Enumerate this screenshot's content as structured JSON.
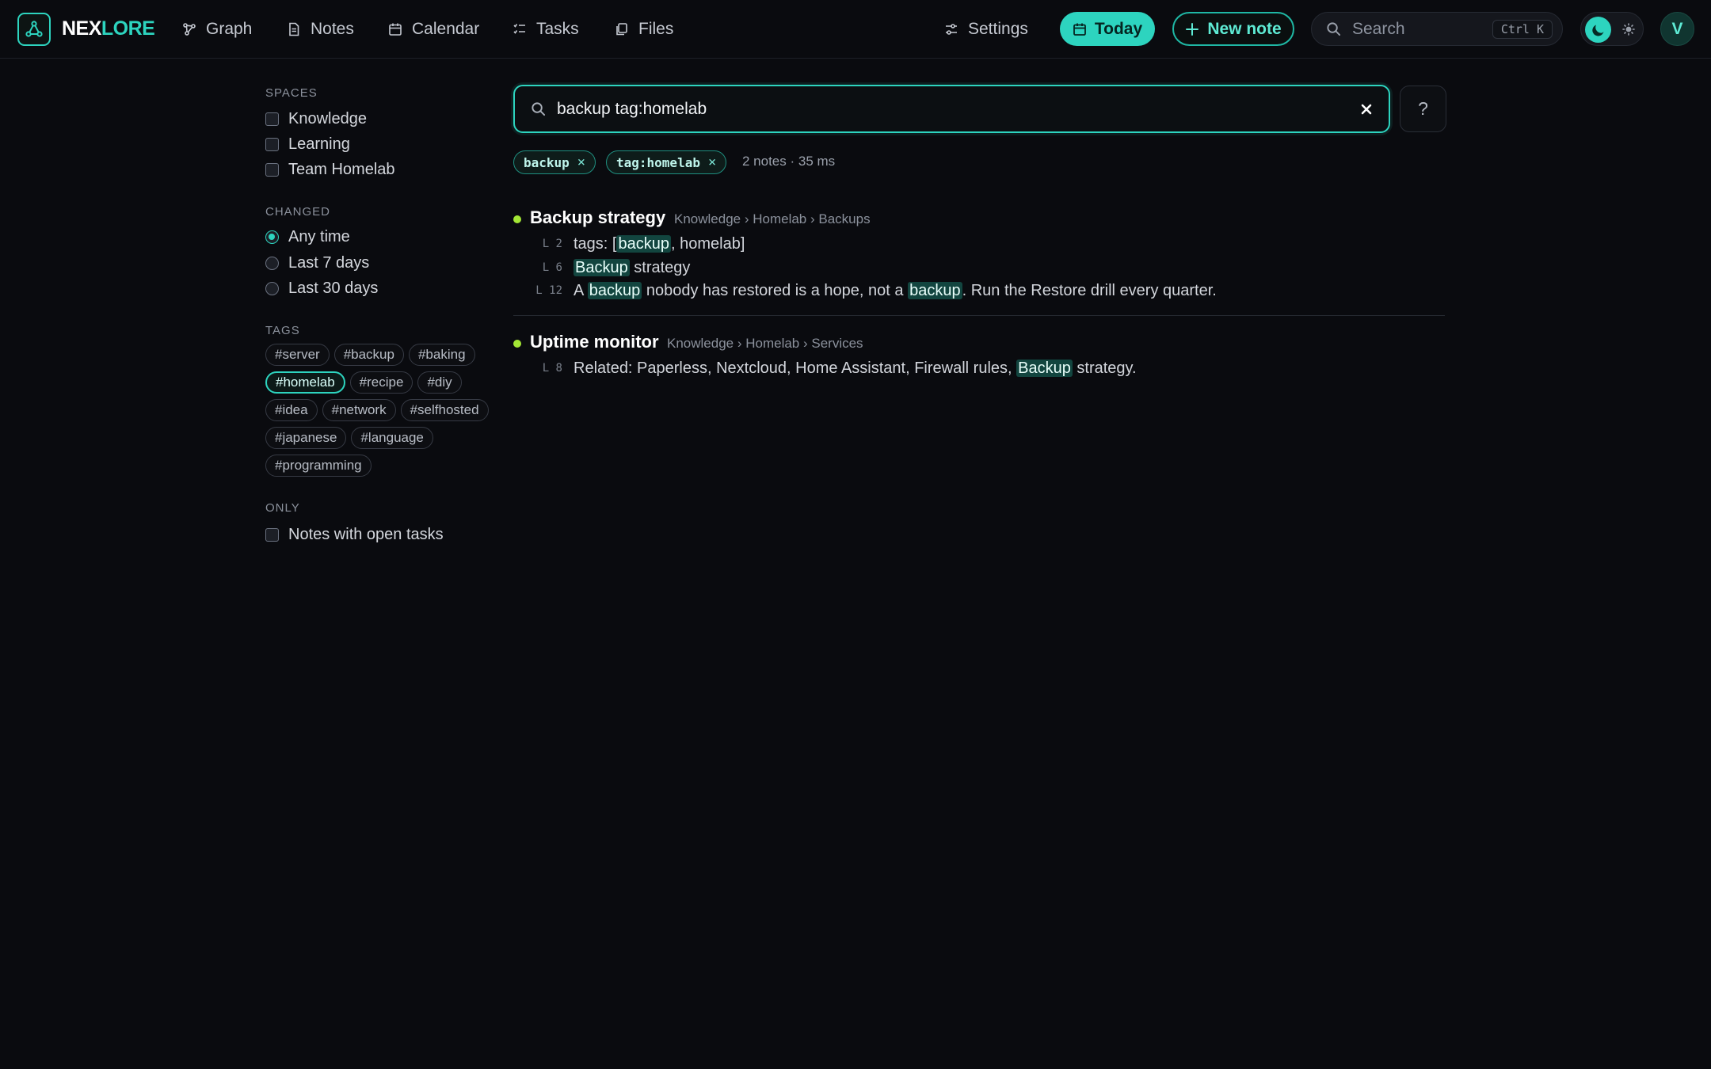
{
  "brand": {
    "part1": "NEX",
    "part2": "LORE"
  },
  "nav": {
    "graph": "Graph",
    "notes": "Notes",
    "calendar": "Calendar",
    "tasks": "Tasks",
    "files": "Files",
    "settings": "Settings"
  },
  "actions": {
    "today": "Today",
    "new_note": "New note"
  },
  "top_search": {
    "placeholder": "Search",
    "shortcut": "Ctrl K"
  },
  "user": {
    "initial": "V"
  },
  "sidebar": {
    "spaces_title": "SPACES",
    "spaces": [
      "Knowledge",
      "Learning",
      "Team Homelab"
    ],
    "changed_title": "CHANGED",
    "changed": [
      "Any time",
      "Last 7 days",
      "Last 30 days"
    ],
    "tags_title": "TAGS",
    "tags": [
      "#server",
      "#backup",
      "#baking",
      "#homelab",
      "#recipe",
      "#diy",
      "#idea",
      "#network",
      "#selfhosted",
      "#japanese",
      "#language",
      "#programming"
    ],
    "only_title": "ONLY",
    "only_open_tasks": "Notes with open tasks"
  },
  "search": {
    "query": "backup tag:homelab",
    "help": "?",
    "chips": [
      "backup",
      "tag:homelab"
    ],
    "chip_remove": "×",
    "meta": "2 notes · 35 ms"
  },
  "results": [
    {
      "title": "Backup strategy",
      "path": "Knowledge › Homelab › Backups",
      "lines": [
        {
          "no": "L 2",
          "pre": "tags: [",
          "hl": "backup",
          "post": ", homelab]"
        },
        {
          "no": "L 6",
          "pre": "",
          "hl": "Backup",
          "post": " strategy"
        },
        {
          "no": "L 12",
          "pre": "A ",
          "hl": "backup",
          "mid": " nobody has restored is a hope, not a ",
          "hl2": "backup",
          "post": ". Run the Restore drill every quarter."
        }
      ]
    },
    {
      "title": "Uptime monitor",
      "path": "Knowledge › Homelab › Services",
      "lines": [
        {
          "no": "L 8",
          "pre": "Related: Paperless, Nextcloud, Home Assistant, Firewall rules, ",
          "hl": "Backup",
          "post": " strategy."
        }
      ]
    }
  ],
  "colors": {
    "accent": "#2dd4bf",
    "match_dot": "#a3e635",
    "background": "#0a0b0f"
  }
}
